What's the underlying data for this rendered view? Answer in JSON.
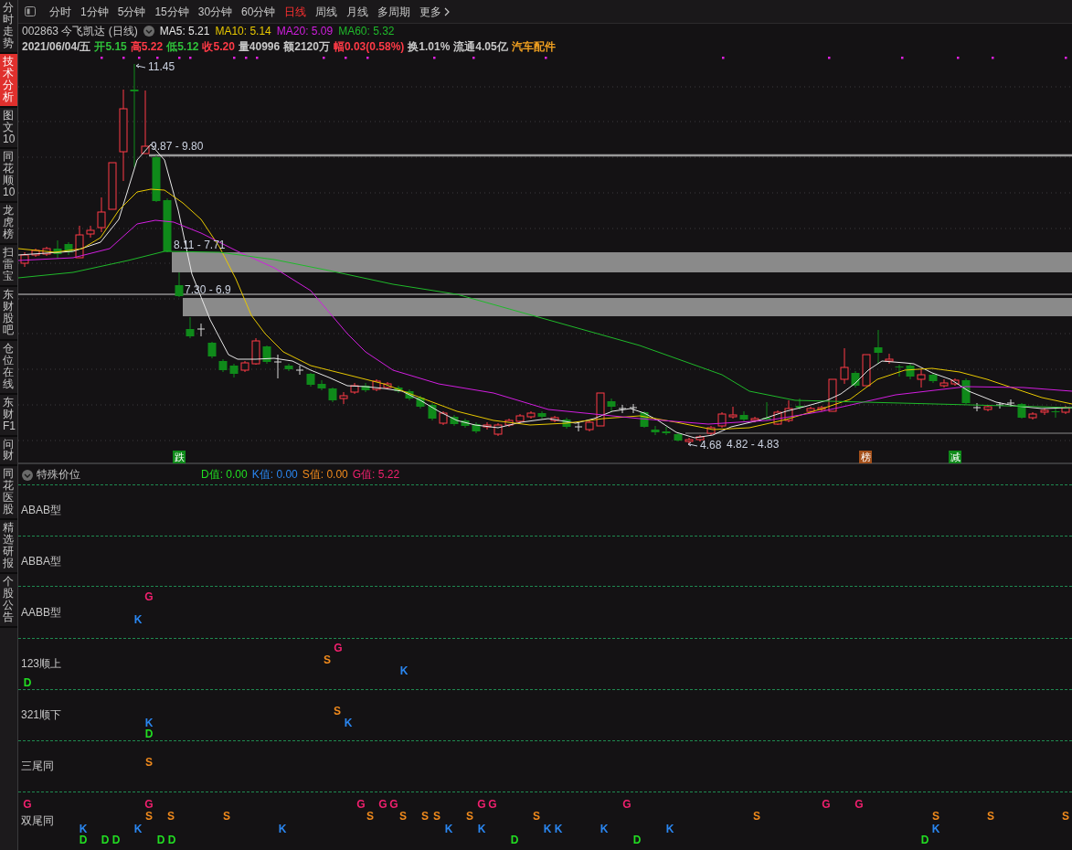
{
  "sidebar": {
    "items": [
      {
        "label": "分时走势",
        "selected": false
      },
      {
        "label": "技术分析",
        "selected": true
      },
      {
        "label": "图文10",
        "selected": false
      },
      {
        "label": "同花顺10",
        "selected": false
      },
      {
        "label": "龙虎榜",
        "selected": false
      },
      {
        "label": "扫雷宝",
        "selected": false
      },
      {
        "label": "东财股吧",
        "selected": false
      },
      {
        "label": "仓位在线",
        "selected": false
      },
      {
        "label": "东财F1",
        "selected": false
      },
      {
        "label": "问财",
        "selected": false
      },
      {
        "label": "同花医股",
        "selected": false
      },
      {
        "label": "精选研报",
        "selected": false
      },
      {
        "label": "个股公告",
        "selected": false
      }
    ]
  },
  "toolbar": {
    "periods": [
      {
        "label": "分时",
        "selected": false
      },
      {
        "label": "1分钟",
        "selected": false
      },
      {
        "label": "5分钟",
        "selected": false
      },
      {
        "label": "15分钟",
        "selected": false
      },
      {
        "label": "30分钟",
        "selected": false
      },
      {
        "label": "60分钟",
        "selected": false
      },
      {
        "label": "日线",
        "selected": true
      },
      {
        "label": "周线",
        "selected": false
      },
      {
        "label": "月线",
        "selected": false
      },
      {
        "label": "多周期",
        "selected": false
      }
    ],
    "more": {
      "label": "更多"
    }
  },
  "quote_header": {
    "title": "002863 今飞凯达 (日线)",
    "moving_averages": [
      {
        "label": "MA5: 5.21",
        "color": "#e8e8e8"
      },
      {
        "label": "MA10: 5.14",
        "color": "#e8c800"
      },
      {
        "label": "MA20: 5.09",
        "color": "#d21ee0"
      },
      {
        "label": "MA60: 5.32",
        "color": "#1fb92a"
      }
    ]
  },
  "quote_stats": [
    {
      "text": "2021/06/04/五",
      "color": "#c8c8c8"
    },
    {
      "text": "开5.15",
      "color": "#2fc13a"
    },
    {
      "text": "高5.22",
      "color": "#ff3a46"
    },
    {
      "text": "低5.12",
      "color": "#2fc13a"
    },
    {
      "text": "收5.20",
      "color": "#ff3a46"
    },
    {
      "text": "量40996",
      "color": "#c8c8c8"
    },
    {
      "text": "额2120万",
      "color": "#c8c8c8"
    },
    {
      "text": "幅0.03(0.58%)",
      "color": "#ff3a46"
    },
    {
      "text": "换1.01%",
      "color": "#c8c8c8"
    },
    {
      "text": "流通4.05亿",
      "color": "#c8c8c8"
    },
    {
      "text": "汽车配件",
      "color": "#f0a020"
    }
  ],
  "chart": {
    "price_labels": [
      {
        "text": "11.45",
        "kind": "extreme"
      },
      {
        "text": "9.87 - 9.80",
        "kind": "zone"
      },
      {
        "text": "8.11 - 7.71",
        "kind": "zone"
      },
      {
        "text": "7.30 - 6.9",
        "kind": "zone"
      },
      {
        "text": "4.68",
        "kind": "extreme"
      },
      {
        "text": "4.82 - 4.83",
        "kind": "zone"
      }
    ],
    "event_markers": [
      {
        "text": "跌",
        "color": "#0f8a1a"
      },
      {
        "text": "榜",
        "color": "#a4501a"
      },
      {
        "text": "减",
        "color": "#0f8a1a"
      }
    ]
  },
  "indicator_panel": {
    "title": "特殊价位",
    "values": [
      {
        "text": "D值: 0.00",
        "color": "#22dd22"
      },
      {
        "text": "K值: 0.00",
        "color": "#2a86f0"
      },
      {
        "text": "S值: 0.00",
        "color": "#f08a1c"
      },
      {
        "text": "G值: 5.22",
        "color": "#f0206e"
      }
    ],
    "rows": [
      {
        "label": "ABAB型"
      },
      {
        "label": "ABBA型"
      },
      {
        "label": "AABB型"
      },
      {
        "label": "123顺上"
      },
      {
        "label": "321顺下"
      },
      {
        "label": "三尾同"
      },
      {
        "label": "双尾同"
      }
    ],
    "signals": [
      {
        "letter": "G",
        "color": "#f0206e"
      },
      {
        "letter": "K",
        "color": "#2a86f0"
      },
      {
        "letter": "G",
        "color": "#f0206e"
      },
      {
        "letter": "S",
        "color": "#f08a1c"
      },
      {
        "letter": "K",
        "color": "#2a86f0"
      },
      {
        "letter": "D",
        "color": "#22dd22"
      },
      {
        "letter": "S",
        "color": "#f08a1c"
      },
      {
        "letter": "K",
        "color": "#2a86f0"
      },
      {
        "letter": "K",
        "color": "#2a86f0"
      },
      {
        "letter": "D",
        "color": "#22dd22"
      },
      {
        "letter": "S",
        "color": "#f08a1c"
      },
      {
        "letter": "G",
        "color": "#f0206e"
      },
      {
        "letter": "G",
        "color": "#f0206e"
      },
      {
        "letter": "G",
        "color": "#f0206e"
      },
      {
        "letter": "G",
        "color": "#f0206e"
      },
      {
        "letter": "G",
        "color": "#f0206e"
      },
      {
        "letter": "G",
        "color": "#f0206e"
      },
      {
        "letter": "G",
        "color": "#f0206e"
      },
      {
        "letter": "G",
        "color": "#f0206e"
      },
      {
        "letter": "G",
        "color": "#f0206e"
      },
      {
        "letter": "G",
        "color": "#f0206e"
      },
      {
        "letter": "S",
        "color": "#f08a1c"
      },
      {
        "letter": "S",
        "color": "#f08a1c"
      },
      {
        "letter": "S",
        "color": "#f08a1c"
      },
      {
        "letter": "S",
        "color": "#f08a1c"
      },
      {
        "letter": "S",
        "color": "#f08a1c"
      },
      {
        "letter": "S",
        "color": "#f08a1c"
      },
      {
        "letter": "S",
        "color": "#f08a1c"
      },
      {
        "letter": "S",
        "color": "#f08a1c"
      },
      {
        "letter": "S",
        "color": "#f08a1c"
      },
      {
        "letter": "S",
        "color": "#f08a1c"
      },
      {
        "letter": "S",
        "color": "#f08a1c"
      },
      {
        "letter": "S",
        "color": "#f08a1c"
      },
      {
        "letter": "S",
        "color": "#f08a1c"
      },
      {
        "letter": "K",
        "color": "#2a86f0"
      },
      {
        "letter": "K",
        "color": "#2a86f0"
      },
      {
        "letter": "K",
        "color": "#2a86f0"
      },
      {
        "letter": "K",
        "color": "#2a86f0"
      },
      {
        "letter": "K",
        "color": "#2a86f0"
      },
      {
        "letter": "K",
        "color": "#2a86f0"
      },
      {
        "letter": "K",
        "color": "#2a86f0"
      },
      {
        "letter": "K",
        "color": "#2a86f0"
      },
      {
        "letter": "K",
        "color": "#2a86f0"
      },
      {
        "letter": "K",
        "color": "#2a86f0"
      },
      {
        "letter": "D",
        "color": "#22dd22"
      },
      {
        "letter": "D",
        "color": "#22dd22"
      },
      {
        "letter": "D",
        "color": "#22dd22"
      },
      {
        "letter": "D",
        "color": "#22dd22"
      },
      {
        "letter": "D",
        "color": "#22dd22"
      },
      {
        "letter": "D",
        "color": "#22dd22"
      },
      {
        "letter": "D",
        "color": "#22dd22"
      },
      {
        "letter": "D",
        "color": "#22dd22"
      }
    ]
  }
}
